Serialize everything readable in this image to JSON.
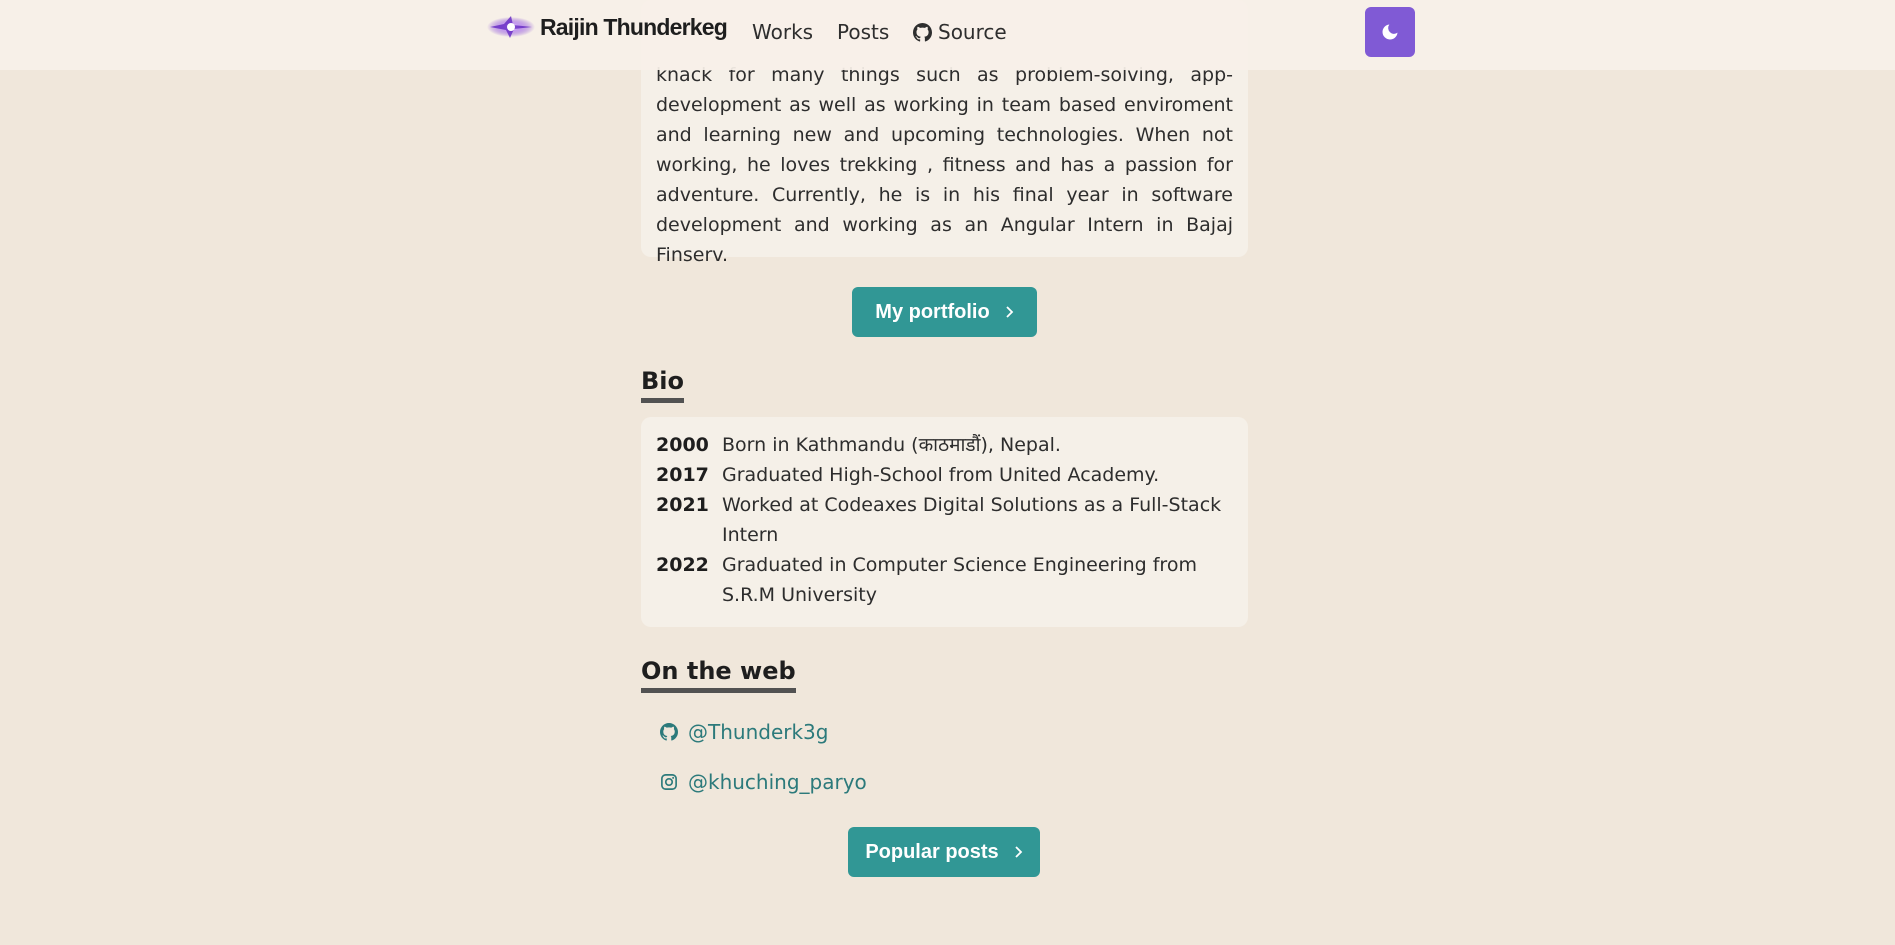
{
  "navbar": {
    "brand": "Raijin Thunderkeg",
    "links": [
      {
        "label": "Works"
      },
      {
        "label": "Posts"
      },
      {
        "label": "Source",
        "icon": "github-icon"
      }
    ],
    "theme_toggle_icon": "moon-icon"
  },
  "about": {
    "text": "knack for many things such as problem-solving, app-development as well as working in team based enviroment and learning new and upcoming technologies. When not working, he loves trekking , fitness and has a passion for adventure. Currently, he is in his final year in software development and working as an Angular Intern in Bajaj Finserv."
  },
  "portfolio_button": {
    "label": "My portfolio",
    "icon": "chevron-right-icon"
  },
  "bio": {
    "heading": "Bio",
    "entries": [
      {
        "year": "2000",
        "text": "Born in Kathmandu (काठमाडौं), Nepal."
      },
      {
        "year": "2017",
        "text": "Graduated High-School from United Academy."
      },
      {
        "year": "2021",
        "text": "Worked at Codeaxes Digital Solutions as a Full-Stack Intern"
      },
      {
        "year": "2022",
        "text": "Graduated in Computer Science Engineering from S.R.M University"
      }
    ]
  },
  "web": {
    "heading": "On the web",
    "links": [
      {
        "label": "@Thunderk3g",
        "icon": "github-icon"
      },
      {
        "label": "@khuching_paryo",
        "icon": "instagram-icon"
      }
    ]
  },
  "popular_button": {
    "label": "Popular posts",
    "icon": "chevron-right-icon"
  },
  "colors": {
    "background": "#f0e7db",
    "card": "#f5f0e8",
    "accent_teal": "#319795",
    "link_teal": "#2c7a7b",
    "theme_button": "#805ad5"
  }
}
